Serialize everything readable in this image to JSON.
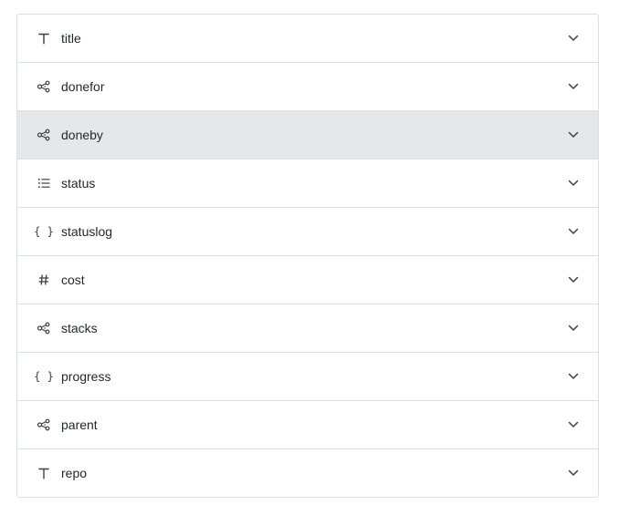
{
  "fields": [
    {
      "name": "title",
      "icon": "text-type-icon",
      "selected": false
    },
    {
      "name": "donefor",
      "icon": "relation-icon",
      "selected": false
    },
    {
      "name": "doneby",
      "icon": "relation-icon",
      "selected": true
    },
    {
      "name": "status",
      "icon": "list-icon",
      "selected": false
    },
    {
      "name": "statuslog",
      "icon": "json-braces-icon",
      "selected": false
    },
    {
      "name": "cost",
      "icon": "number-hash-icon",
      "selected": false
    },
    {
      "name": "stacks",
      "icon": "relation-icon",
      "selected": false
    },
    {
      "name": "progress",
      "icon": "json-braces-icon",
      "selected": false
    },
    {
      "name": "parent",
      "icon": "relation-icon",
      "selected": false
    },
    {
      "name": "repo",
      "icon": "text-type-icon",
      "selected": false
    }
  ],
  "icons": {
    "braces_glyph": "{ }"
  },
  "colors": {
    "selected_row_bg": "#e4e8eb",
    "border": "#dcdfe3",
    "text": "#24272b"
  }
}
